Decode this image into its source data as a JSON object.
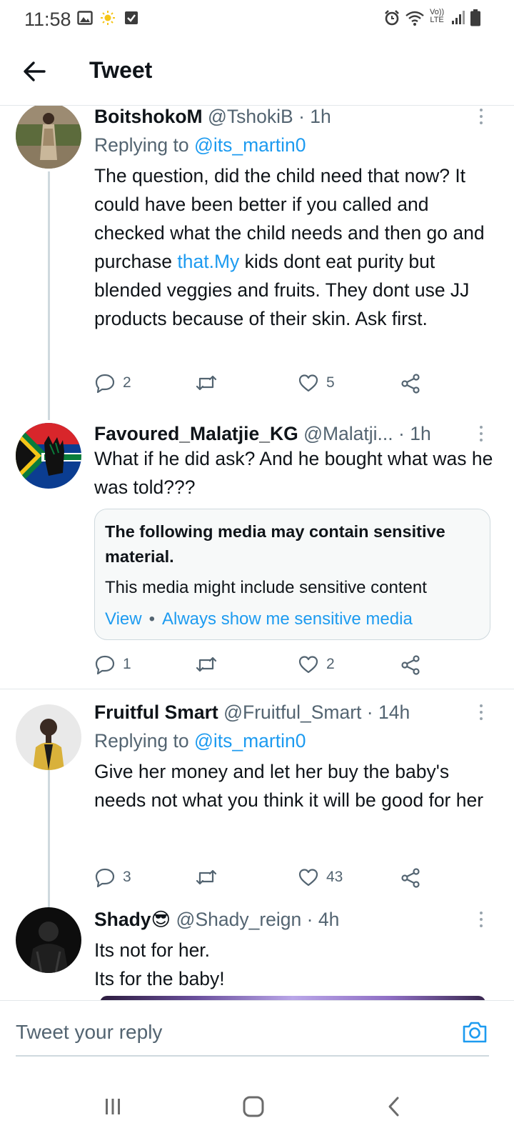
{
  "status_bar": {
    "time": "11:58",
    "left_icons": [
      "gallery-icon",
      "sun-icon",
      "checkbox-icon"
    ],
    "right_icons": [
      "alarm-icon",
      "wifi-icon",
      "volte-icon",
      "signal-icon",
      "battery-icon"
    ],
    "volte_top": "Vo))",
    "volte_bottom": "LTE"
  },
  "header": {
    "back_icon": "arrow-left-icon",
    "title": "Tweet"
  },
  "tweets": [
    {
      "name": "BoitshokoM",
      "handle": "@TshokiB",
      "time": "· 1h",
      "replying_prefix": "Replying to ",
      "replying_handle": "@its_martin0",
      "text_part1": "The question, did the child need that now? It could have been better if you called and checked what the child needs and then go and purchase ",
      "text_link": "that.My",
      "text_part2": " kids dont eat purity but blended veggies and fruits. They dont use JJ products because of their skin. Ask first.",
      "replies": "2",
      "retweets": "",
      "likes": "5"
    },
    {
      "name": "Favoured_Malatjie_KG",
      "handle": "@Malatji...",
      "time": "· 1h",
      "text": "What if he did ask? And he bought what was he was told???",
      "sensitive": {
        "title": "The following media may contain sensitive material.",
        "description": "This media might include sensitive content",
        "view_label": "View",
        "separator": "•",
        "always_label": "Always show me sensitive media"
      },
      "replies": "1",
      "retweets": "",
      "likes": "2"
    },
    {
      "name": "Fruitful Smart",
      "handle": "@Fruitful_Smart",
      "time": "· 14h",
      "replying_prefix": "Replying to ",
      "replying_handle": "@its_martin0",
      "text": "Give her money and let her buy the baby's needs not what you think it will be good for her",
      "replies": "3",
      "retweets": "",
      "likes": "43"
    },
    {
      "name": "Shady",
      "name_emoji": "😎",
      "handle": "@Shady_reign",
      "time": "· 4h",
      "text": "Its not for her.\nIts for the baby!"
    }
  ],
  "compose": {
    "placeholder": "Tweet your reply",
    "camera_icon": "camera-icon"
  },
  "nav": {
    "icons": [
      "recents-icon",
      "home-icon",
      "back-icon"
    ]
  },
  "colors": {
    "accent": "#1d9bf0",
    "text_primary": "#0f1419",
    "text_secondary": "#536471",
    "divider": "#e3e7ea"
  }
}
